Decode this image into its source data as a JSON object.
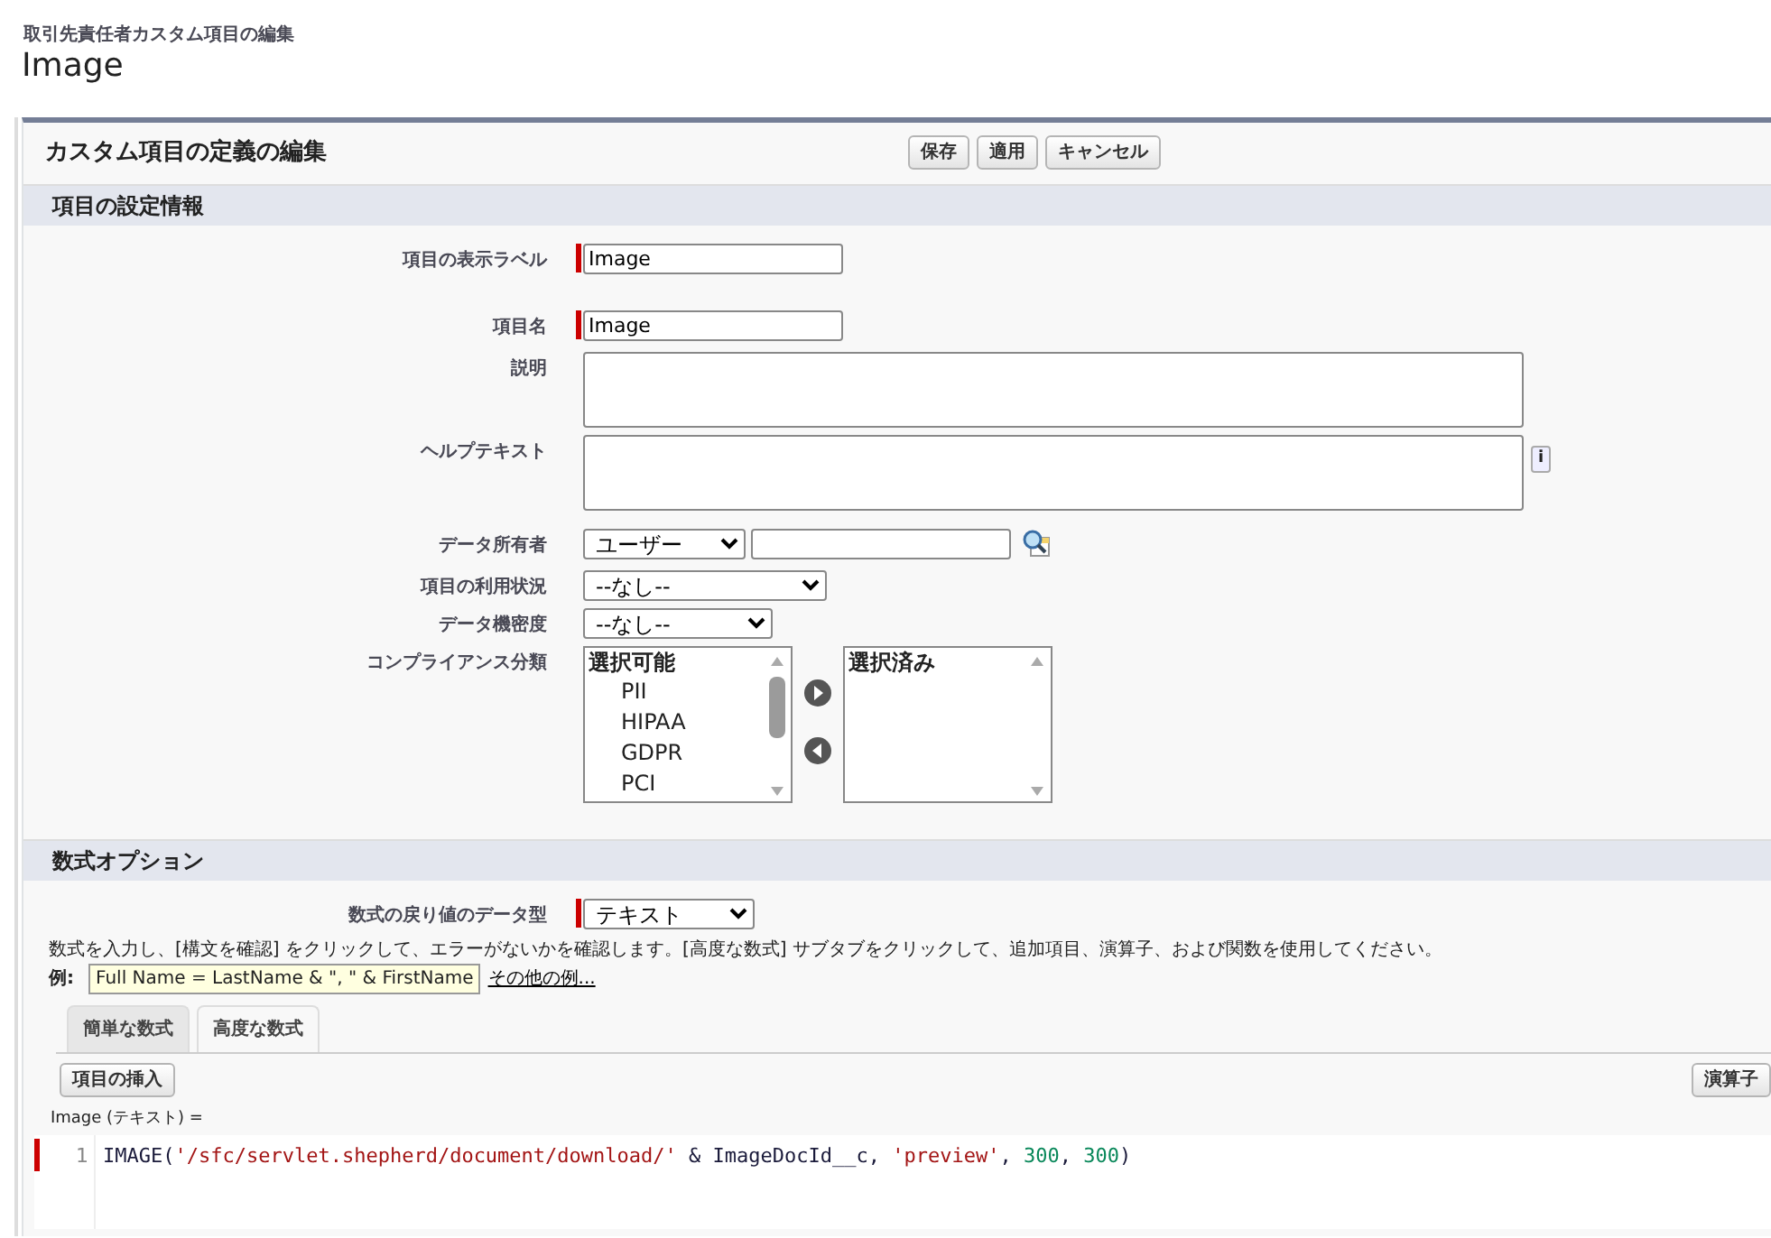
{
  "breadcrumb": "取引先責任者カスタム項目の編集",
  "page_title": "Image",
  "panel": {
    "title": "カスタム項目の定義の編集",
    "buttons": [
      "保存",
      "適用",
      "キャンセル"
    ]
  },
  "field_settings": {
    "heading": "項目の設定情報",
    "rows": [
      {
        "kind": "text",
        "label": "項目の表示ラベル",
        "value": "Image",
        "required": true
      },
      {
        "kind": "text",
        "label": "項目名",
        "value": "Image",
        "required": true
      },
      {
        "kind": "textarea",
        "label": "説明",
        "required": false
      },
      {
        "kind": "textarea",
        "label": "ヘルプテキスト",
        "required": false,
        "info_icon": "i"
      },
      {
        "kind": "lookup",
        "label": "データ所有者",
        "value": "ユーザー",
        "required": false
      },
      {
        "kind": "select",
        "label": "項目の利用状況",
        "value": "--なし--",
        "required": false
      },
      {
        "kind": "select",
        "label": "データ機密度",
        "value": "--なし--",
        "required": false
      },
      {
        "kind": "dual_list",
        "label": "コンプライアンス分類",
        "required": false,
        "available_heading": "選択可能",
        "available": [
          "PII",
          "HIPAA",
          "GDPR",
          "PCI"
        ],
        "selected_heading": "選択済み"
      }
    ]
  },
  "formula_options": {
    "heading": "数式オプション",
    "return_type": {
      "label": "数式の戻り値のデータ型",
      "value": "テキスト",
      "required": true
    },
    "instructions": "数式を入力し、[構文を確認] をクリックして、エラーがないかを確認します。[高度な数式] サブタブをクリックして、追加項目、演算子、および関数を使用してください。",
    "example_label": "例:",
    "example": "Full Name = LastName & \", \" & FirstName",
    "more_examples_link": "その他の例...",
    "tabs": [
      {
        "label": "簡単な数式",
        "selected": false
      },
      {
        "label": "高度な数式",
        "selected": true
      }
    ],
    "buttons": [
      "項目の挿入",
      "演算子"
    ],
    "editor_label": "Image (テキスト) =",
    "code_lines": [
      {
        "number": "1",
        "marked": true,
        "tokens": [
          {
            "kind": "plain",
            "text": "IMAGE("
          },
          {
            "kind": "string",
            "text": "'/sfc/servlet.shepherd/document/download/'"
          },
          {
            "kind": "plain",
            "text": " & ImageDocId__c, "
          },
          {
            "kind": "string",
            "text": "'preview'"
          },
          {
            "kind": "plain",
            "text": ", "
          },
          {
            "kind": "number",
            "text": "300"
          },
          {
            "kind": "plain",
            "text": ", "
          },
          {
            "kind": "number",
            "text": "300"
          },
          {
            "kind": "plain",
            "text": ")"
          }
        ]
      }
    ]
  }
}
